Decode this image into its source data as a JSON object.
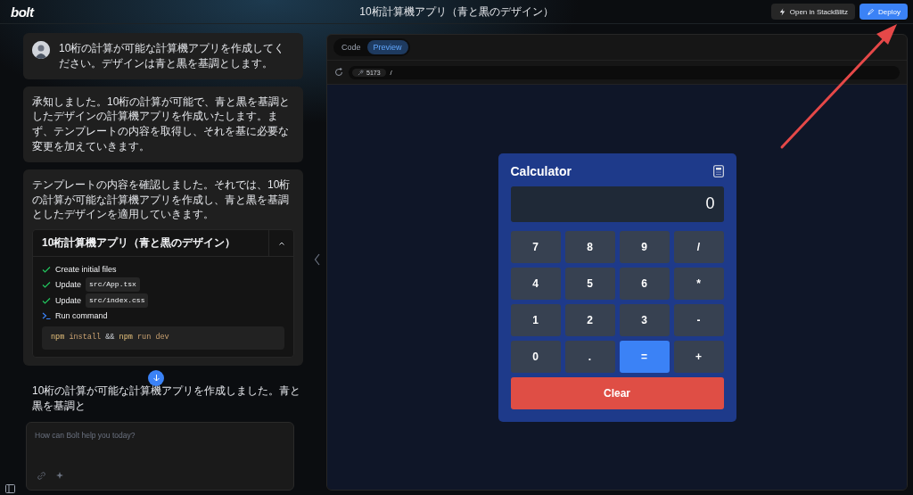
{
  "header": {
    "logo": "bolt",
    "title": "10桁計算機アプリ（青と黒のデザイン）",
    "buttons": [
      {
        "label": "Open in StackBlitz",
        "kind": "secondary"
      },
      {
        "label": "Deploy",
        "kind": "primary"
      }
    ]
  },
  "messages": [
    {
      "kind": "user",
      "text": "10桁の計算が可能な計算機アプリを作成してください。デザインは青と黒を基調とします。"
    },
    {
      "kind": "assistant",
      "text": "承知しました。10桁の計算が可能で、青と黒を基調としたデザインの計算機アプリを作成いたします。まず、テンプレートの内容を取得し、それを基に必要な変更を加えていきます。"
    },
    {
      "kind": "assistant",
      "text": "テンプレートの内容を確認しました。それでは、10桁の計算が可能な計算機アプリを作成し、青と黒を基調としたデザインを適用していきます。",
      "artifact": {
        "title": "10桁計算機アプリ（青と黒のデザイン）",
        "expanded": true,
        "steps": [
          {
            "kind": "done",
            "label": "Create initial files"
          },
          {
            "kind": "done",
            "label": "Update",
            "code": "src/App.tsx"
          },
          {
            "kind": "done",
            "label": "Update",
            "code": "src/index.css"
          },
          {
            "kind": "command",
            "label": "Run command",
            "tokens": [
              {
                "text": "npm",
                "kind": "cmd"
              },
              {
                "text": "install",
                "kind": "arg"
              },
              {
                "text": "&&",
                "kind": "op"
              },
              {
                "text": "npm",
                "kind": "cmd"
              },
              {
                "text": "run dev",
                "kind": "arg"
              }
            ]
          }
        ]
      }
    },
    {
      "kind": "assistant",
      "text": "10桁の計算が可能な計算機アプリを作成しました。青と黒を基調と"
    }
  ],
  "input": {
    "placeholder": "How can Bolt help you today?"
  },
  "preview": {
    "tabs": [
      {
        "label": "Code",
        "selected": false
      },
      {
        "label": "Preview",
        "selected": true
      }
    ],
    "port": "5173",
    "path": "/",
    "calculator": {
      "title": "Calculator",
      "display": "0",
      "keys": [
        {
          "label": "7",
          "kind": "key"
        },
        {
          "label": "8",
          "kind": "key"
        },
        {
          "label": "9",
          "kind": "key"
        },
        {
          "label": "/",
          "kind": "key"
        },
        {
          "label": "4",
          "kind": "key"
        },
        {
          "label": "5",
          "kind": "key"
        },
        {
          "label": "6",
          "kind": "key"
        },
        {
          "label": "*",
          "kind": "key"
        },
        {
          "label": "1",
          "kind": "key"
        },
        {
          "label": "2",
          "kind": "key"
        },
        {
          "label": "3",
          "kind": "key"
        },
        {
          "label": "-",
          "kind": "key"
        },
        {
          "label": "0",
          "kind": "key"
        },
        {
          "label": ".",
          "kind": "key"
        },
        {
          "label": "=",
          "kind": "equals"
        },
        {
          "label": "+",
          "kind": "key"
        }
      ],
      "clear": "Clear"
    }
  }
}
